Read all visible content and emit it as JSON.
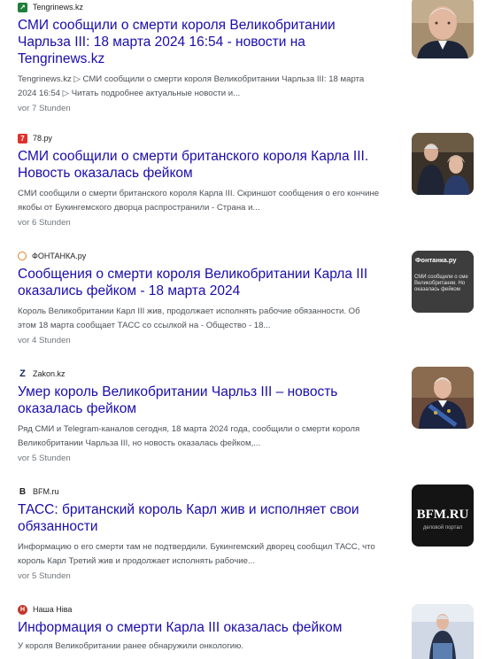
{
  "results": [
    {
      "source": "Tengrinews.kz",
      "title": "СМИ сообщили о смерти короля Великобритании Чарльза III: 18 марта 2024 16:54 - новости на Tengrinews.kz",
      "snippet": "Tengrinews.kz ▷ СМИ сообщили о смерти короля Великобритании Чарльза III: 18 марта 2024 16:54 ▷ Читать подробнее актуальные новости и...",
      "time": "vor 7 Stunden",
      "favicon_icon": "tengrinews-logo-icon",
      "favicon_color": "#1e7f3a"
    },
    {
      "source": "78.ру",
      "title": "СМИ сообщили о смерти британского короля Карла III. Новость оказалась фейком",
      "snippet": "СМИ сообщили о смерти британского короля Карла III. Скриншот сообщения о его кончине якобы от Букингемского дворца распространили - Страна и...",
      "time": "vor 6 Stunden",
      "favicon_icon": "78ru-logo-icon",
      "favicon_color": "#e0312a"
    },
    {
      "source": "ФОНТАНКА.ру",
      "title": "Сообщения о смерти короля Великобритании Карла III оказались фейком - 18 марта 2024",
      "snippet": "Король Великобритании Карл III жив, продолжает исполнять рабочие обязанности. Об этом 18 марта сообщает ТАСС со ссылкой на - Общество - 18...",
      "time": "vor 4 Stunden",
      "favicon_icon": "fontanka-logo-icon",
      "favicon_color": "#d9822b",
      "thumb_lines": [
        "Фонтанка.ру",
        "СМИ сообщили о сме",
        "Великобритании. Но",
        "оказалась фейком"
      ]
    },
    {
      "source": "Zakon.kz",
      "title": "Умер король Великобритании Чарльз III – новость оказалась фейком",
      "snippet": "Ряд СМИ и Telegram-каналов сегодня, 18 марта 2024 года, сообщили о смерти короля Великобритании Чарльза III, но новость оказалась фейком,...",
      "time": "vor 5 Stunden",
      "favicon_icon": "zakon-logo-icon",
      "favicon_color": "#1a2a5a"
    },
    {
      "source": "BFM.ru",
      "title": "ТАСС: британский король Карл жив и исполняет свои обязанности",
      "snippet": "Информацию о его смерти там не подтвердили. Букингемский дворец сообщил ТАСС, что король Карл Третий жив и продолжает исполнять рабочие...",
      "time": "vor 5 Stunden",
      "favicon_icon": "bfm-logo-icon",
      "favicon_color": "#222222",
      "thumb_lines": [
        "BFM.RU",
        "деловой портал"
      ]
    },
    {
      "source": "Наша Ніва",
      "title": "Информация о смерти Карла III оказалась фейком",
      "snippet": "У короля Великобритании ранее обнаружили онкологию.",
      "time": "",
      "favicon_icon": "nashaniva-logo-icon",
      "favicon_color": "#c0392b"
    }
  ]
}
